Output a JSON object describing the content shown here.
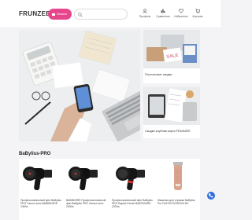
{
  "header": {
    "logo": "FRUNZEE",
    "catalog_label": "Каталог",
    "search_placeholder": "",
    "nav": [
      {
        "label": "Профиль",
        "icon": "user-icon"
      },
      {
        "label": "Сравнение",
        "icon": "compare-icon"
      },
      {
        "label": "Избранное",
        "icon": "heart-icon"
      },
      {
        "label": "Корзина",
        "icon": "cart-icon"
      }
    ]
  },
  "promo": {
    "card1_caption": "Постоянные скидки",
    "card2_caption": "Скидки клубная карта FRUNZEE"
  },
  "section": {
    "title": "BaByliss-PRO",
    "products": [
      {
        "name": "Профессиональный фен BaByliss PRO Caruso Ionic BAB6510IRE 2400w"
      },
      {
        "name": "BAB6520RE Профессиональный фен BaByliss PRO Caruso Ionic 2400w"
      },
      {
        "name": "Профессиональный фен BaByliss PRO Rapido Ferrari BAB7000IRE 2200w"
      },
      {
        "name": "Машинка для стрижки BaByliss Pro FX8700 ROSEGOLDE"
      }
    ]
  },
  "colors": {
    "accent": "#e7468d",
    "chat": "#2d6cdf"
  }
}
